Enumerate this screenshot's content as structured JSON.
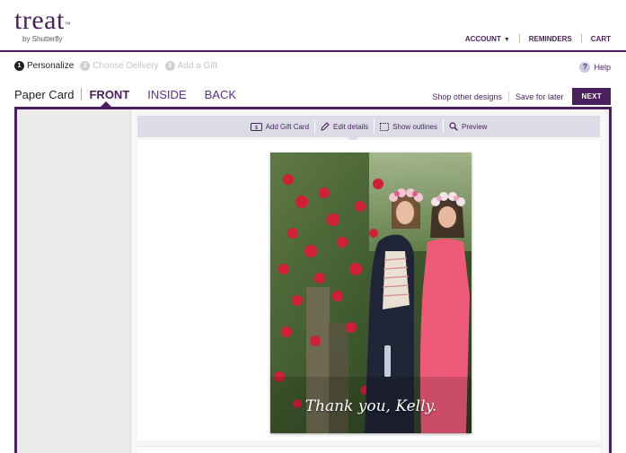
{
  "logo": {
    "name": "treat",
    "tm": "™",
    "sub": "by Shutterfly"
  },
  "topnav": {
    "account": "ACCOUNT",
    "reminders": "REMINDERS",
    "cart": "CART"
  },
  "steps": [
    {
      "num": "1",
      "label": "Personalize"
    },
    {
      "num": "2",
      "label": "Choose Delivery"
    },
    {
      "num": "3",
      "label": "Add a Gift"
    }
  ],
  "help": {
    "icon": "?",
    "label": "Help"
  },
  "cardnav": {
    "type": "Paper Card",
    "front": "FRONT",
    "inside": "INSIDE",
    "back": "BACK"
  },
  "actions": {
    "shop": "Shop other designs",
    "save": "Save for later",
    "next": "NEXT"
  },
  "toolbar": {
    "gift_card": "Add Gift Card",
    "edit": "Edit details",
    "outlines": "Show outlines",
    "preview": "Preview"
  },
  "card": {
    "message": "Thank you, Kelly."
  },
  "colors": {
    "brand": "#4a1f5e",
    "link": "#5b2d8a",
    "toolbar_bg": "#dcdce6"
  }
}
